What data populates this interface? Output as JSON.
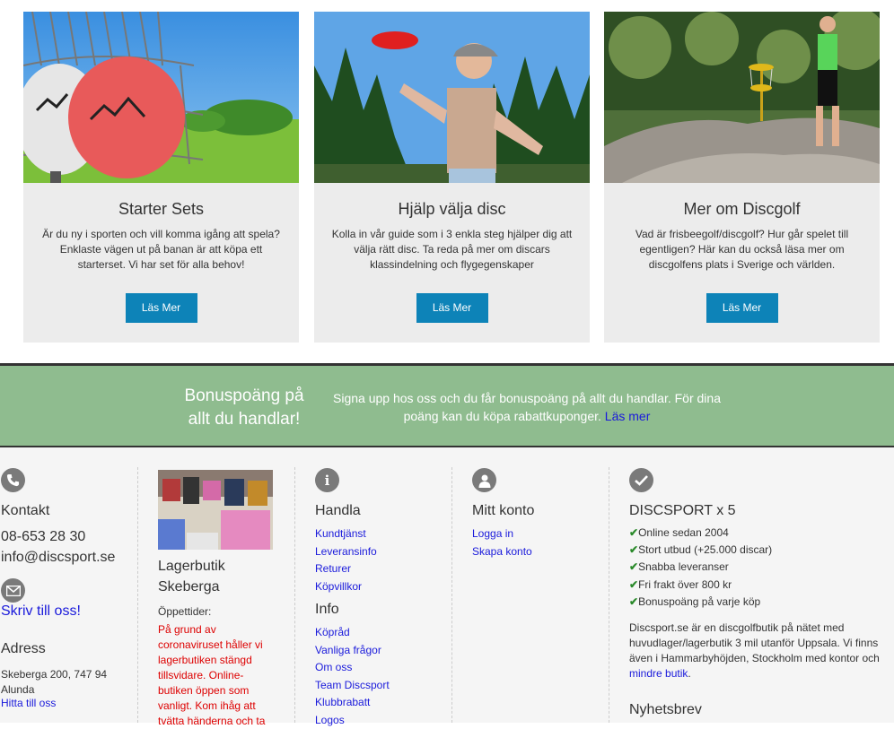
{
  "cards": [
    {
      "title": "Starter Sets",
      "text": "Är du ny i sporten och vill komma igång att spela? Enklaste vägen ut på banan är att köpa ett starterset. Vi har set för alla behov!",
      "button": "Läs Mer"
    },
    {
      "title": "Hjälp välja disc",
      "text": "Kolla in vår guide som i 3 enkla steg hjälper dig att välja rätt disc. Ta reda på mer om discars klassindelning och flygegenskaper",
      "button": "Läs Mer"
    },
    {
      "title": "Mer om Discgolf",
      "text": "Vad är frisbeegolf/discgolf? Hur går spelet till egentligen? Här kan du också läsa mer om discgolfens plats i Sverige och världen.",
      "button": "Läs Mer"
    }
  ],
  "bonus": {
    "title": "Bonuspoäng på allt du handlar!",
    "text": "Signa upp hos oss och du får bonuspoäng på allt du handlar. För dina poäng kan du köpa rabattkuponger.",
    "link": "Läs mer"
  },
  "footer": {
    "contact": {
      "heading": "Kontakt",
      "phone": "08-653 28 30",
      "email": "info@discsport.se",
      "write_link": "Skriv till oss!",
      "address_heading": "Adress",
      "address_line1": "Skeberga 200, 747 94",
      "address_line2": "Alunda",
      "directions_link": "Hitta till oss"
    },
    "store": {
      "heading_line1": "Lagerbutik",
      "heading_line2": "Skeberga",
      "hours_label": "Öppettider:",
      "notice": "På grund av coronaviruset håller vi lagerbutiken stängd tillsvidare. Online-butiken öppen som vanligt. Kom ihåg att tvätta händerna och ta"
    },
    "shop": {
      "heading": "Handla",
      "links": [
        "Kundtjänst",
        "Leveransinfo",
        "Returer",
        "Köpvillkor"
      ],
      "info_heading": "Info",
      "info_links": [
        "Köpråd",
        "Vanliga frågor",
        "Om oss",
        "Team Discsport",
        "Klubbrabatt",
        "Logos"
      ]
    },
    "account": {
      "heading": "Mitt konto",
      "links": [
        "Logga in",
        "Skapa konto"
      ]
    },
    "about": {
      "heading": "DISCSPORT x 5",
      "usps": [
        "Online sedan 2004",
        "Stort utbud (+25.000 discar)",
        "Snabba leveranser",
        "Fri frakt över 800 kr",
        "Bonuspoäng på varje köp"
      ],
      "description": "Discsport.se är en discgolfbutik på nätet med huvudlager/lagerbutik 3 mil utanför Uppsala. Vi finns även i Hammarbyhöjden, Stockholm med kontor och",
      "description_link": "mindre butik",
      "newsletter_heading": "Nyhetsbrev"
    }
  },
  "icons": {
    "contact": "phone-icon",
    "write": "envelope-icon",
    "shop": "info-icon",
    "account": "user-icon",
    "about": "checkmark-icon",
    "usp": "check-icon"
  },
  "colors": {
    "button": "#0d83b8",
    "bonus_bg": "#8fbc8f",
    "link": "#1a1adb",
    "notice": "#dd0000",
    "check": "#2b8a2b"
  }
}
